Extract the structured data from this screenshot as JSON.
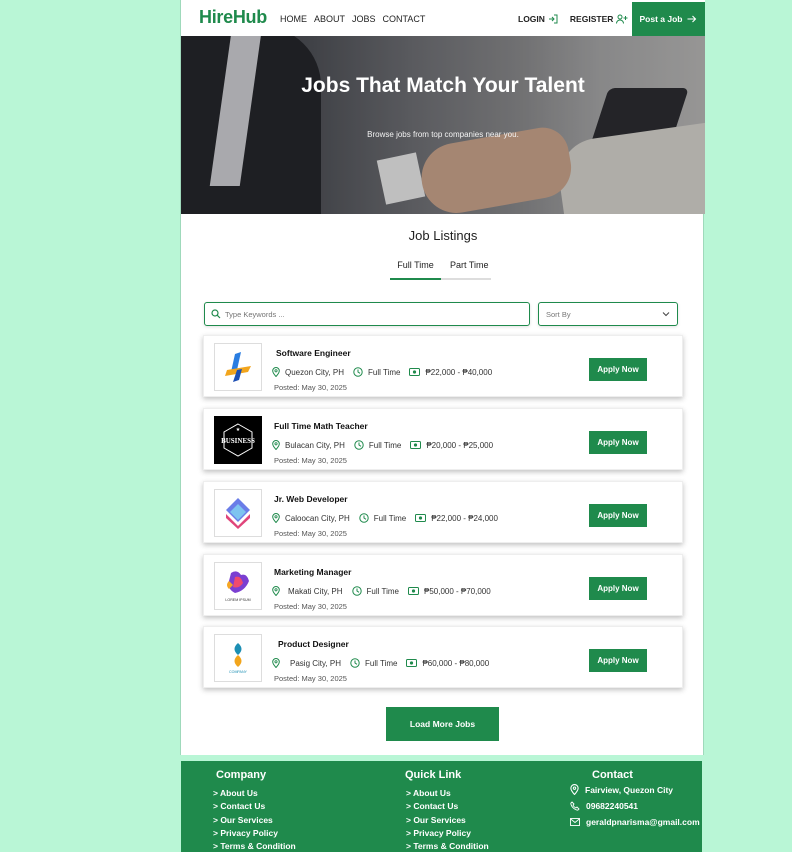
{
  "nav": {
    "logo": "HireHub",
    "links": [
      "HOME",
      "ABOUT",
      "JOBS",
      "CONTACT"
    ],
    "login": "LOGIN",
    "register": "REGISTER",
    "post_job": "Post a Job"
  },
  "hero": {
    "title": "Jobs That Match Your Talent",
    "subtitle": "Browse jobs from top companies near you."
  },
  "listings": {
    "title": "Job Listings",
    "tabs": [
      "Full Time",
      "Part Time"
    ],
    "search_placeholder": "Type Keywords ...",
    "sort_label": "Sort By",
    "apply_label": "Apply Now",
    "load_more": "Load More Jobs",
    "jobs": [
      {
        "title": "Software Engineer",
        "location": "Quezon City, PH",
        "type": "Full Time",
        "salary": "₱22,000 - ₱40,000",
        "posted": "Posted: May 30, 2025"
      },
      {
        "title": "Full Time Math Teacher",
        "location": "Bulacan City, PH",
        "type": "Full Time",
        "salary": "₱20,000 - ₱25,000",
        "posted": "Posted: May 30, 2025",
        "logo_text": "BUSINESS"
      },
      {
        "title": "Jr. Web Developer",
        "location": "Caloocan City, PH",
        "type": "Full Time",
        "salary": "₱22,000 - ₱24,000",
        "posted": "Posted: May 30, 2025"
      },
      {
        "title": "Marketing Manager",
        "location": "Makati City, PH",
        "type": "Full Time",
        "salary": "₱50,000 - ₱70,000",
        "posted": "Posted: May 30, 2025",
        "logo_text": "LOREM IPSUM"
      },
      {
        "title": "Product Designer",
        "location": "Pasig City, PH",
        "type": "Full Time",
        "salary": "₱60,000 - ₱80,000",
        "posted": "Posted: May 30, 2025",
        "logo_text": "COMPANY"
      }
    ]
  },
  "footer": {
    "company": {
      "title": "Company",
      "links": [
        "> About Us",
        "> Contact Us",
        "> Our Services",
        "> Privacy Policy",
        "> Terms & Condition"
      ]
    },
    "quick": {
      "title": "Quick Link",
      "links": [
        "> About Us",
        "> Contact Us",
        "> Our Services",
        "> Privacy Policy",
        "> Terms & Condition"
      ]
    },
    "contact": {
      "title": "Contact",
      "address": "Fairview, Quezon City",
      "phone": "09682240541",
      "email": "geraldpnarisma@gmail.com"
    }
  },
  "colors": {
    "brand": "#1f8a4c",
    "background": "#b9f6d6"
  }
}
